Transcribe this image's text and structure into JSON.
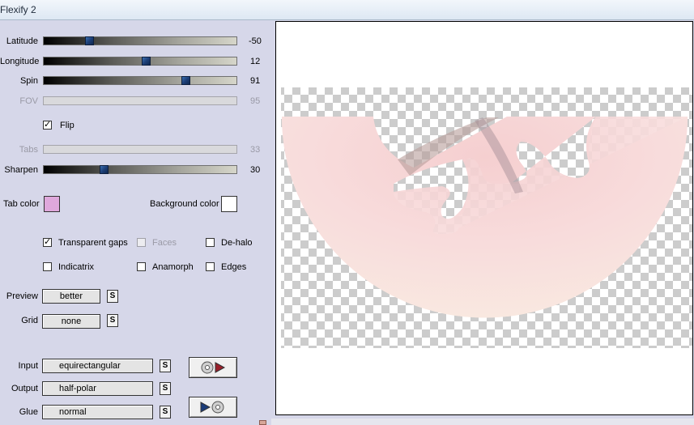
{
  "window": {
    "title": "Flexify 2"
  },
  "sliders": [
    {
      "label": "Latitude",
      "value": "-50",
      "position": 0.235,
      "enabled": true
    },
    {
      "label": "Longitude",
      "value": "12",
      "position": 0.53,
      "enabled": true
    },
    {
      "label": "Spin",
      "value": "91",
      "position": 0.735,
      "enabled": true
    },
    {
      "label": "FOV",
      "value": "95",
      "enabled": false
    },
    {
      "label": "Tabs",
      "value": "33",
      "enabled": false
    },
    {
      "label": "Sharpen",
      "value": "30",
      "position": 0.31,
      "enabled": true
    }
  ],
  "flip": {
    "label": "Flip",
    "checked": true
  },
  "colors": {
    "tab_label": "Tab color",
    "tab_value": "#dfa8dc",
    "background_label": "Background color",
    "background_value": "#ffffff"
  },
  "options": [
    {
      "label": "Transparent gaps",
      "checked": true,
      "enabled": true
    },
    {
      "label": "Faces",
      "checked": false,
      "enabled": false
    },
    {
      "label": "De-halo",
      "checked": false,
      "enabled": true
    },
    {
      "label": "Indicatrix",
      "checked": false,
      "enabled": true
    },
    {
      "label": "Anamorph",
      "checked": false,
      "enabled": true
    },
    {
      "label": "Edges",
      "checked": false,
      "enabled": true
    }
  ],
  "preview": {
    "label": "Preview",
    "value": "better",
    "s_label": "S"
  },
  "grid": {
    "label": "Grid",
    "value": "none",
    "s_label": "S"
  },
  "projection": {
    "input_label": "Input",
    "input_value": "equirectangular",
    "output_label": "Output",
    "output_value": "half-polar",
    "glue_label": "Glue",
    "glue_value": "normal",
    "s_label": "S"
  },
  "icons": {
    "load": "disc-play-icon",
    "save": "play-disc-icon"
  }
}
